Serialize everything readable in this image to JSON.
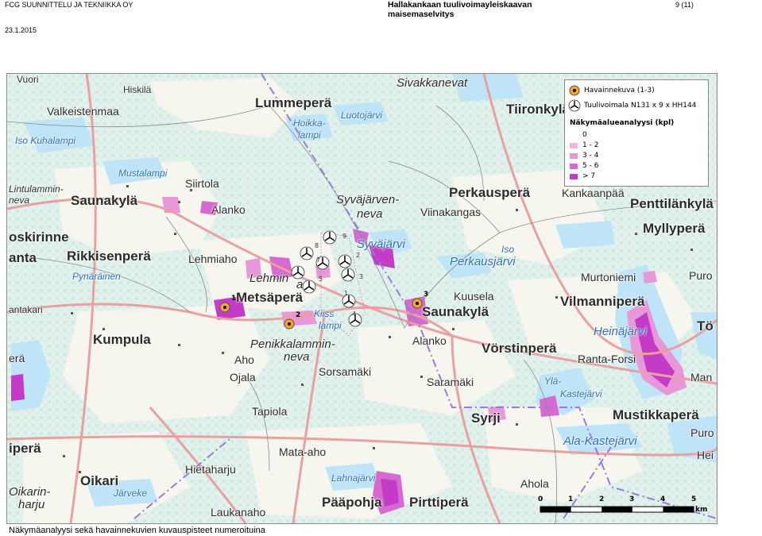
{
  "header": {
    "company": "FCG SUUNNITTELU JA TEKNIIKKA OY",
    "date": "23.1.2015",
    "title_line1": "Hallakankaan tuulivoimayleiskaavan",
    "title_line2": "maisemaselvitys",
    "page": "9 (11)"
  },
  "legend": {
    "viewpoint_label": "Havainnekuva (1-3)",
    "turbine_label": "Tuulivoimala N131 x 9 x HH144",
    "analysis_title": "Näkymäalueanalyysi (kpl)",
    "classes": [
      {
        "label": "0",
        "color": "#ffffff"
      },
      {
        "label": "1 - 2",
        "color": "#f2b6de"
      },
      {
        "label": "3 - 4",
        "color": "#e898d8"
      },
      {
        "label": "5 - 6",
        "color": "#d66ad0"
      },
      {
        "label": "> 7",
        "color": "#c33bc7"
      }
    ]
  },
  "map": {
    "places": [
      {
        "text": "Vuori",
        "cls": "p-sm"
      },
      {
        "text": "Hiskilä",
        "cls": "p-sm"
      },
      {
        "text": "Lummeperä",
        "cls": "p-big"
      },
      {
        "text": "Sivakkanevat",
        "cls": "p-ital"
      },
      {
        "text": "Valkeistenmaa",
        "cls": "p-mid"
      },
      {
        "text": "Iso Kuhalampi",
        "cls": "p-lake"
      },
      {
        "text": "Hoikka-",
        "cls": "p-lake"
      },
      {
        "text": "lampi",
        "cls": "p-lake"
      },
      {
        "text": "Luotojärvi",
        "cls": "p-lake"
      },
      {
        "text": "Tiironkylä",
        "cls": "p-big"
      },
      {
        "text": "Mustalampi",
        "cls": "p-lake"
      },
      {
        "text": "Siirtola",
        "cls": "p-mid"
      },
      {
        "text": "Lintulammin-",
        "cls": "p-ital-s"
      },
      {
        "text": "neva",
        "cls": "p-ital-s"
      },
      {
        "text": "Saunakylä",
        "cls": "p-big"
      },
      {
        "text": "Alanko",
        "cls": "p-mid"
      },
      {
        "text": "Syväjärven-",
        "cls": "p-ital"
      },
      {
        "text": "neva",
        "cls": "p-ital"
      },
      {
        "text": "Perkausperä",
        "cls": "p-big"
      },
      {
        "text": "Kankaanpää",
        "cls": "p-mid"
      },
      {
        "text": "Viinakangas",
        "cls": "p-mid"
      },
      {
        "text": "Penttilänkylä",
        "cls": "p-big"
      },
      {
        "text": "Myllyperä",
        "cls": "p-big"
      },
      {
        "text": "oskirinne",
        "cls": "p-big"
      },
      {
        "text": "anta",
        "cls": "p-big"
      },
      {
        "text": "Rikkisenperä",
        "cls": "p-big"
      },
      {
        "text": "Pynäräinen",
        "cls": "p-lake"
      },
      {
        "text": "Lehmiaho",
        "cls": "p-mid"
      },
      {
        "text": "Syväjärvi",
        "cls": "p-lake-big"
      },
      {
        "text": "Perkausjärvi",
        "cls": "p-lake-big"
      },
      {
        "text": "Iso",
        "cls": "p-lake"
      },
      {
        "text": "Lehmin",
        "cls": "p-ital"
      },
      {
        "text": "a",
        "cls": "p-ital"
      },
      {
        "text": "Metsäperä",
        "cls": "p-big"
      },
      {
        "text": "Murtoniemi",
        "cls": "p-mid"
      },
      {
        "text": "Puro",
        "cls": "p-mid"
      },
      {
        "text": "Vilmanniperä",
        "cls": "p-big"
      },
      {
        "text": "Kuusela",
        "cls": "p-mid"
      },
      {
        "text": "Saunakylä",
        "cls": "p-big"
      },
      {
        "text": "antakari",
        "cls": "p-sm"
      },
      {
        "text": "Kiiss",
        "cls": "p-lake"
      },
      {
        "text": "lampi",
        "cls": "p-lake"
      },
      {
        "text": "Heinäjärvi",
        "cls": "p-lake-big"
      },
      {
        "text": "Tö",
        "cls": "p-big"
      },
      {
        "text": "Kumpula",
        "cls": "p-big"
      },
      {
        "text": "Penikkalammin-",
        "cls": "p-ital"
      },
      {
        "text": "neva",
        "cls": "p-ital"
      },
      {
        "text": "Alanko",
        "cls": "p-mid"
      },
      {
        "text": "Vörstinperä",
        "cls": "p-big"
      },
      {
        "text": "Ranta-Forsi",
        "cls": "p-mid"
      },
      {
        "text": "erä",
        "cls": "p-mid"
      },
      {
        "text": "Aho",
        "cls": "p-mid"
      },
      {
        "text": "Ojala",
        "cls": "p-mid"
      },
      {
        "text": "Sorsamäki",
        "cls": "p-mid"
      },
      {
        "text": "Saramäki",
        "cls": "p-mid"
      },
      {
        "text": "Ylä-",
        "cls": "p-lake"
      },
      {
        "text": "Kastejärvi",
        "cls": "p-lake"
      },
      {
        "text": "Man",
        "cls": "p-mid"
      },
      {
        "text": "Mustikkaperä",
        "cls": "p-big"
      },
      {
        "text": "Tapiola",
        "cls": "p-mid"
      },
      {
        "text": "Syrji",
        "cls": "p-big"
      },
      {
        "text": "Puro",
        "cls": "p-mid"
      },
      {
        "text": "Ala-Kastejärvi",
        "cls": "p-lake-big"
      },
      {
        "text": "iperä",
        "cls": "p-big"
      },
      {
        "text": "Mata-aho",
        "cls": "p-mid"
      },
      {
        "text": "Hei",
        "cls": "p-mid"
      },
      {
        "text": "Hietaharju",
        "cls": "p-mid"
      },
      {
        "text": "Oikari",
        "cls": "p-big"
      },
      {
        "text": "Oikarin-",
        "cls": "p-ital"
      },
      {
        "text": "harju",
        "cls": "p-ital"
      },
      {
        "text": "Järveke",
        "cls": "p-lake"
      },
      {
        "text": "Lahnajärvi",
        "cls": "p-lake"
      },
      {
        "text": "Ahola",
        "cls": "p-mid"
      },
      {
        "text": "Pääpohja",
        "cls": "p-big"
      },
      {
        "text": "Pirttiperä",
        "cls": "p-big"
      },
      {
        "text": "Laukanaho",
        "cls": "p-mid"
      }
    ],
    "turbine_numbers": [
      "9",
      "8",
      "7",
      "2",
      "6",
      "3",
      "5",
      "1",
      "4"
    ],
    "viewpoints": [
      "1",
      "2",
      "3"
    ]
  },
  "scale": {
    "ticks": [
      "0",
      "1",
      "2",
      "3",
      "4",
      "5"
    ],
    "unit": "km"
  },
  "caption": "Näkymäanalyysi sekä havainnekuvien kuvauspisteet numeroituina"
}
